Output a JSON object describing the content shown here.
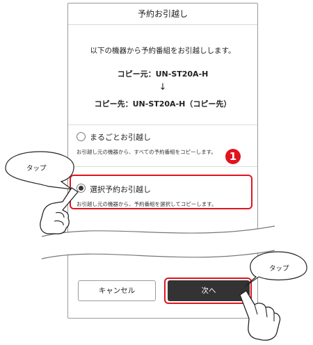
{
  "header": {
    "title": "予約お引越し"
  },
  "intro": "以下の機器から予約番組をお引越しします。",
  "copy": {
    "source": "コピー元：UN-ST20A-H",
    "arrow": "↓",
    "destination": "コピー先：UN-ST20A-H（コピー先）"
  },
  "options": [
    {
      "label": "まるごとお引越し",
      "description": "お引越し元の機器から、すべての予約番組をコピーします。",
      "selected": false
    },
    {
      "label": "選択予約お引越し",
      "description": "お引越し元の機器から、予約番組を選択してコピーします。",
      "selected": true
    }
  ],
  "buttons": {
    "cancel": "キャンセル",
    "next": "次へ"
  },
  "annotations": {
    "step_number": "1",
    "tap_left": "タップ",
    "tap_right": "タップ",
    "highlight_color": "#e0141e"
  }
}
